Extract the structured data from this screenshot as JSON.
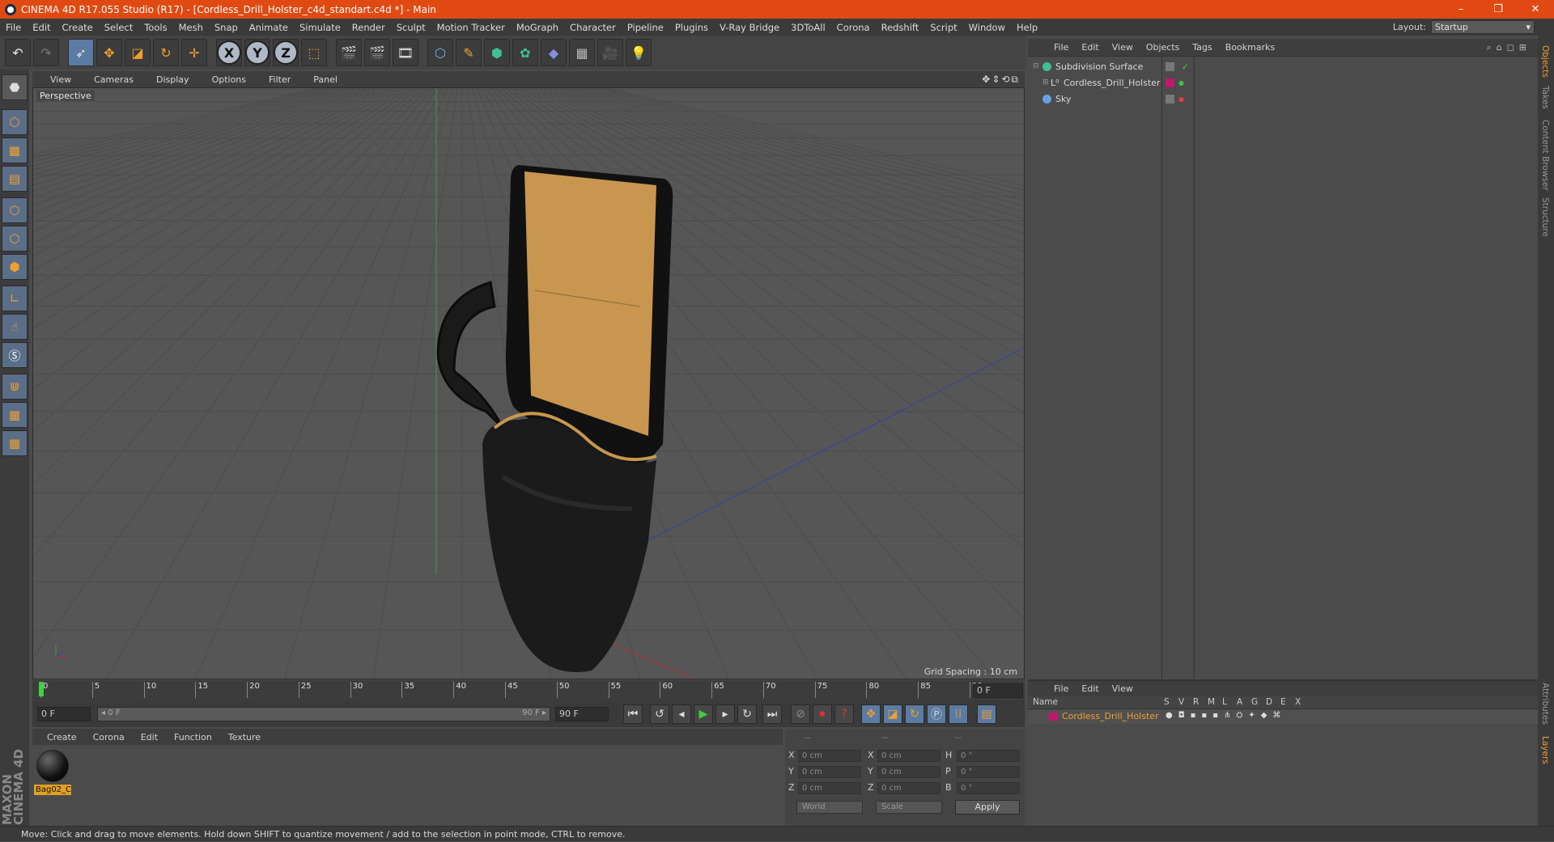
{
  "window": {
    "title": "CINEMA 4D R17.055 Studio (R17) - [Cordless_Drill_Holster_c4d_standart.c4d *] - Main",
    "minimize": "–",
    "maximize": "❐",
    "close": "✕"
  },
  "menubar": {
    "items": [
      "File",
      "Edit",
      "Create",
      "Select",
      "Tools",
      "Mesh",
      "Snap",
      "Animate",
      "Simulate",
      "Render",
      "Sculpt",
      "Motion Tracker",
      "MoGraph",
      "Character",
      "Pipeline",
      "Plugins",
      "V-Ray Bridge",
      "3DToAll",
      "Corona",
      "Redshift",
      "Script",
      "Window",
      "Help"
    ],
    "layout_label": "Layout:",
    "layout_value": "Startup"
  },
  "viewport": {
    "menu": [
      "View",
      "Cameras",
      "Display",
      "Options",
      "Filter",
      "Panel"
    ],
    "label": "Perspective",
    "grid_spacing": "Grid Spacing : 10 cm",
    "colors": {
      "bg": "#565656",
      "grid": "#4a4a4a",
      "x_axis": "#b03030",
      "y_axis": "#3aa03a",
      "z_axis": "#3040b0"
    }
  },
  "timeline": {
    "ticks": [
      "0",
      "5",
      "10",
      "15",
      "20",
      "25",
      "30",
      "35",
      "40",
      "45",
      "50",
      "55",
      "60",
      "65",
      "70",
      "75",
      "80",
      "85",
      "90"
    ],
    "current_frame": "0 F"
  },
  "playbar": {
    "start_field": "0 F",
    "range_start": "◂ 0 F",
    "range_end": "90 F ▸",
    "end_field": "90 F"
  },
  "material_manager": {
    "menu": [
      "Create",
      "Corona",
      "Edit",
      "Function",
      "Texture"
    ],
    "materials": [
      {
        "name": "Bag02_C"
      }
    ]
  },
  "coordinates": {
    "header": [
      "--",
      "--",
      "--"
    ],
    "rows": [
      {
        "a": "X",
        "av": "0 cm",
        "b": "X",
        "bv": "0 cm",
        "c": "H",
        "cv": "0 °"
      },
      {
        "a": "Y",
        "av": "0 cm",
        "b": "Y",
        "bv": "0 cm",
        "c": "P",
        "cv": "0 °"
      },
      {
        "a": "Z",
        "av": "0 cm",
        "b": "Z",
        "bv": "0 cm",
        "c": "B",
        "cv": "0 °"
      }
    ],
    "mode_world": "World",
    "mode_scale": "Scale",
    "apply": "Apply"
  },
  "object_manager": {
    "menu": [
      "File",
      "Edit",
      "View",
      "Objects",
      "Tags",
      "Bookmarks"
    ],
    "objects": [
      {
        "name": "Subdivision Surface",
        "icon_color": "#40c090"
      },
      {
        "name": "Cordless_Drill_Holster",
        "icon_color": "#dddddd",
        "tag_color": "#c0186a"
      },
      {
        "name": "Sky",
        "icon_color": "#6aa0e0"
      }
    ]
  },
  "layer_manager": {
    "menu": [
      "File",
      "Edit",
      "View"
    ],
    "columns": [
      "Name",
      "S",
      "V",
      "R",
      "M",
      "L",
      "A",
      "G",
      "D",
      "E",
      "X"
    ],
    "layers": [
      {
        "name": "Cordless_Drill_Holster",
        "color": "#c0186a"
      }
    ]
  },
  "right_tabs": [
    "Objects",
    "Takes",
    "Content Browser",
    "Structure",
    "Attributes",
    "Layers"
  ],
  "maxon_logo": "MAXON CINEMA 4D",
  "status": "Move: Click and drag to move elements. Hold down SHIFT to quantize movement / add to the selection in point mode, CTRL to remove."
}
